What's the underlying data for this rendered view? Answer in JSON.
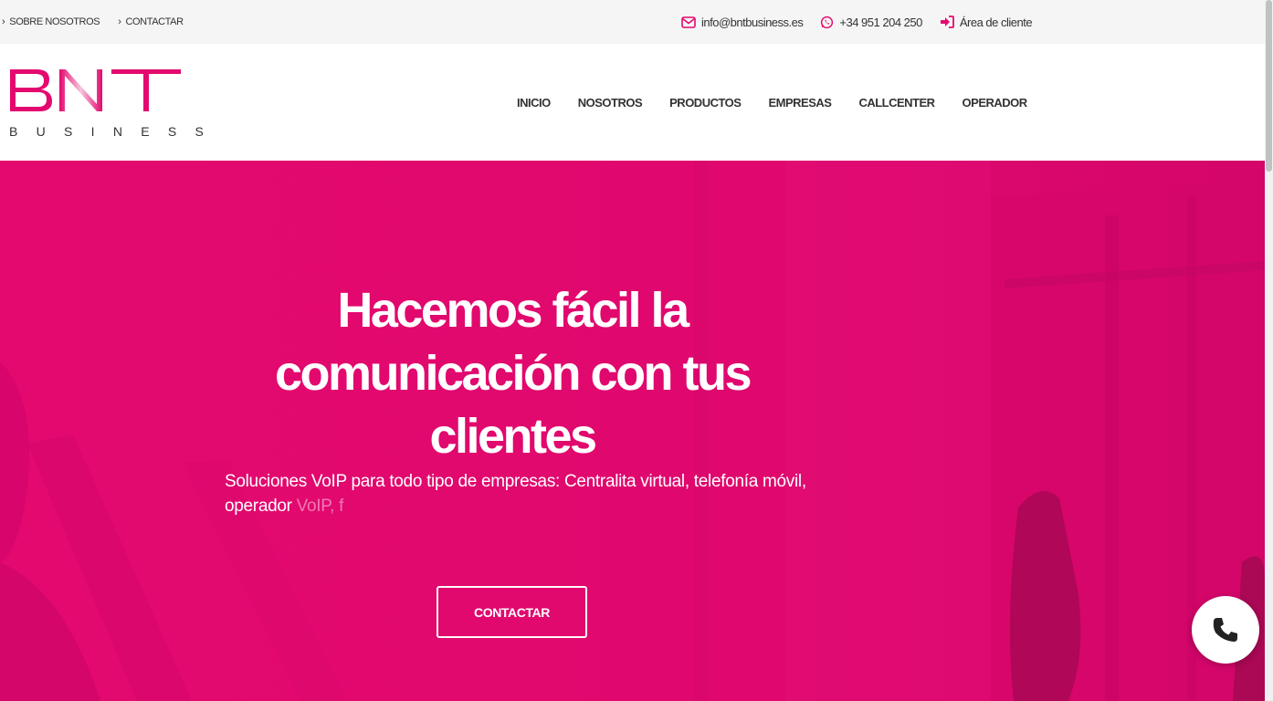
{
  "topbar": {
    "links": [
      {
        "label": "SOBRE NOSOTROS"
      },
      {
        "label": "CONTACTAR"
      }
    ],
    "email": "info@bntbusiness.es",
    "phone": "+34 951 204 250",
    "client_area": "Área de cliente"
  },
  "logo": {
    "mark": "BNT",
    "tagline": "BUSINESS"
  },
  "nav": {
    "items": [
      {
        "label": "INICIO"
      },
      {
        "label": "NOSOTROS"
      },
      {
        "label": "PRODUCTOS"
      },
      {
        "label": "EMPRESAS"
      },
      {
        "label": "CALLCENTER"
      },
      {
        "label": "OPERADOR"
      }
    ]
  },
  "hero": {
    "title_lines": [
      "Hacemos fácil la",
      "comunicación con tus",
      "clientes"
    ],
    "subtitle_main": "Soluciones VoIP para todo tipo de empresas: Centralita virtual, telefonía móvil,",
    "subtitle_line2_solid": "operador ",
    "subtitle_line2_faded": "VoIP, f",
    "cta_label": "CONTACTAR"
  },
  "colors": {
    "brand": "#e3096f",
    "brand_dark": "#b8005a",
    "topbar_bg": "#f5f5f5",
    "text": "#333333"
  },
  "icons": {
    "email": "envelope-icon",
    "phone": "whatsapp-icon",
    "client_area": "sign-in-icon",
    "call": "phone-icon",
    "top_link": "chevron-right-icon"
  }
}
